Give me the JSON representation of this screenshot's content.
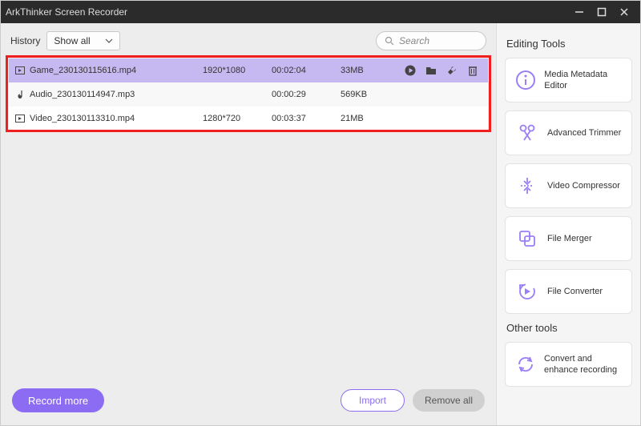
{
  "window": {
    "title": "ArkThinker Screen Recorder"
  },
  "history": {
    "label": "History",
    "filter": "Show all",
    "search_placeholder": "Search"
  },
  "files": [
    {
      "name": "Game_230130115616.mp4",
      "resolution": "1920*1080",
      "duration": "00:02:04",
      "size": "33MB",
      "type": "video",
      "selected": true
    },
    {
      "name": "Audio_230130114947.mp3",
      "resolution": "",
      "duration": "00:00:29",
      "size": "569KB",
      "type": "audio",
      "selected": false
    },
    {
      "name": "Video_230130113310.mp4",
      "resolution": "1280*720",
      "duration": "00:03:37",
      "size": "21MB",
      "type": "video",
      "selected": false
    }
  ],
  "buttons": {
    "record": "Record more",
    "import": "Import",
    "remove_all": "Remove all"
  },
  "sidebar": {
    "title1": "Editing Tools",
    "title2": "Other tools",
    "tools": [
      {
        "label": "Media Metadata Editor",
        "icon": "info"
      },
      {
        "label": "Advanced Trimmer",
        "icon": "scissors"
      },
      {
        "label": "Video Compressor",
        "icon": "compress"
      },
      {
        "label": "File Merger",
        "icon": "merge"
      },
      {
        "label": "File Converter",
        "icon": "convert"
      }
    ],
    "other": [
      {
        "label": "Convert and enhance recording",
        "icon": "refresh"
      }
    ]
  }
}
